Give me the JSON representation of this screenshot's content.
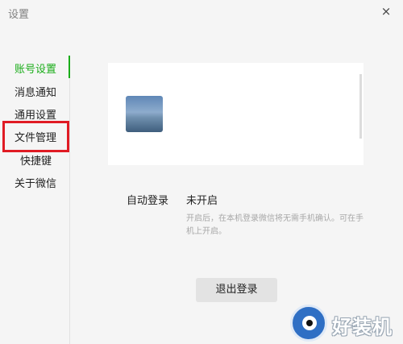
{
  "window": {
    "title": "设置",
    "close_glyph": "×"
  },
  "sidebar": {
    "items": [
      {
        "label": "账号设置",
        "active": true
      },
      {
        "label": "消息通知",
        "active": false
      },
      {
        "label": "通用设置",
        "active": false
      },
      {
        "label": "文件管理",
        "active": false,
        "highlighted": true
      },
      {
        "label": "快捷键",
        "active": false
      },
      {
        "label": "关于微信",
        "active": false
      }
    ]
  },
  "account": {
    "avatar_icon": "avatar-photo",
    "auto_login": {
      "label": "自动登录",
      "value": "未开启",
      "description": "开启后，在本机登录微信将无需手机确认。可在手机上开启。"
    },
    "logout_label": "退出登录"
  },
  "watermark": {
    "text": "好装机"
  },
  "colors": {
    "accent": "#1aad19",
    "highlight": "#e01b24"
  }
}
